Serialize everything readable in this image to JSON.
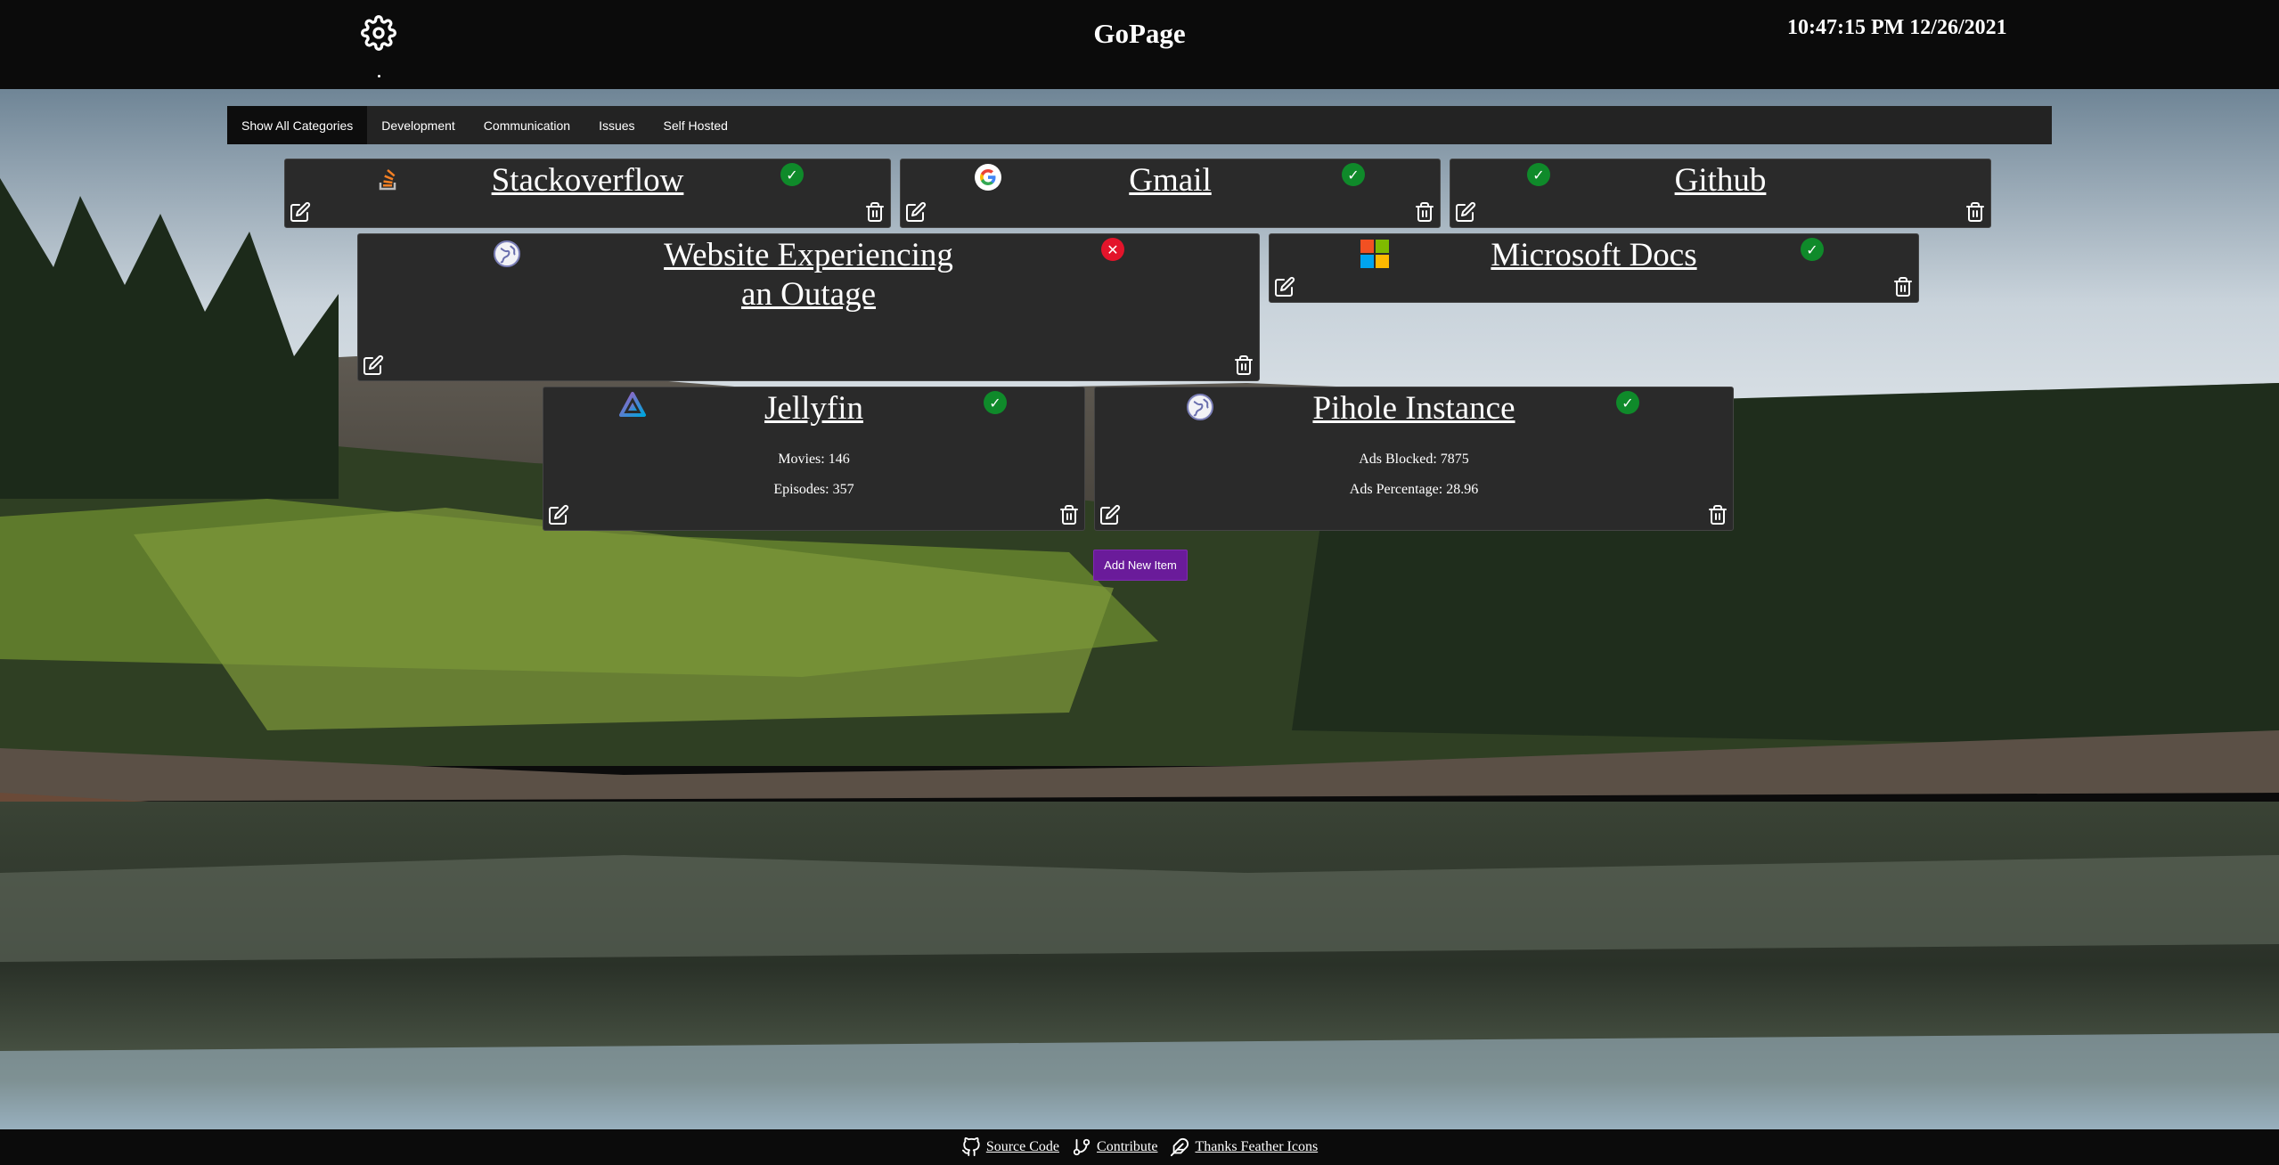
{
  "header": {
    "title": "GoPage",
    "clock": "10:47:15 PM 12/26/2021"
  },
  "categories": [
    {
      "label": "Show All Categories",
      "active": true
    },
    {
      "label": "Development",
      "active": false
    },
    {
      "label": "Communication",
      "active": false
    },
    {
      "label": "Issues",
      "active": false
    },
    {
      "label": "Self Hosted",
      "active": false
    }
  ],
  "cards": {
    "stackoverflow": {
      "title": "Stackoverflow",
      "status": "up",
      "icon": "stackoverflow-icon"
    },
    "gmail": {
      "title": "Gmail",
      "status": "up",
      "icon": "google-icon"
    },
    "github": {
      "title": "Github",
      "status": "up",
      "icon": "none"
    },
    "outage": {
      "title": "Website Experiencing an Outage",
      "status": "down",
      "icon": "globe-icon"
    },
    "msdocs": {
      "title": "Microsoft Docs",
      "status": "up",
      "icon": "microsoft-icon"
    },
    "jellyfin": {
      "title": "Jellyfin",
      "status": "up",
      "icon": "jellyfin-icon",
      "stats": [
        "Movies: 146",
        "Episodes: 357"
      ]
    },
    "pihole": {
      "title": "Pihole Instance",
      "status": "up",
      "icon": "globe-icon",
      "stats": [
        "Ads Blocked: 7875",
        "Ads Percentage: 28.96"
      ]
    }
  },
  "add_button": "Add New Item",
  "footer": {
    "source": "Source Code",
    "contribute": "Contribute",
    "thanks": "Thanks Feather Icons"
  },
  "colors": {
    "status_up": "#0f8a2a",
    "status_down": "#e3142b",
    "add_button": "#6a1b9a",
    "card_bg": "#2a2a2a"
  }
}
